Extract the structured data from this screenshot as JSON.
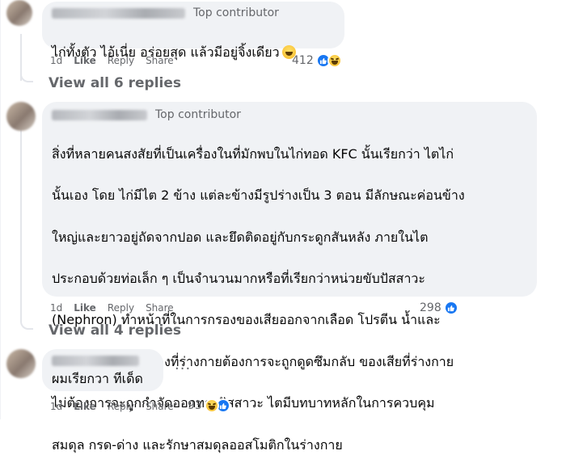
{
  "comments": [
    {
      "badge": "Top contributor",
      "text": "ไก่ทั้งตัว ไอ้เนี่ย อร่อยสุด แล้วมีอยู่จิ้งเดียว",
      "time": "1d",
      "like": "Like",
      "reply": "Reply",
      "share": "Share",
      "reaction_count": "412",
      "reactions": [
        "like-icon",
        "haha-icon"
      ],
      "view_replies": "View all 6 replies"
    },
    {
      "badge": "Top contributor",
      "text": "สิ่งที่หลายคนสงสัยที่เป็นเครื่องในที่มักพบในไก่ทอด KFC นั้นเรียกว่า ไตไก่ นั้นเอง โดย ไก่มีไต 2 ข้าง แต่ละข้างมีรูปร่างเป็น 3 ตอน มีลักษณะค่อนข้างใหญ่และยาวอยู่ถัดจากปอด และยึดติดอยู่กับกระดูกสันหลัง ภายในไตประกอบด้วยท่อเล็ก ๆ เป็นจำนวนมากหรือที่เรียกว่าหน่วยขับปัสสาวะ (Nephron) ทำหน้าที่ในการกรองของเสียออกจากเลือด โปรตีน น้ำและสารประกอบบางอย่างที่ร่างกายต้องการจะถูกดูดซึมกลับ ของเสียที่ร่างกายไม่ต้องการจะถูกกำจัดออกทางปัสสาวะ ไตมีบทบาทหลักในการควบคุมสมดุล กรด-ด่าง และรักษาสมดุลออสโมติกในร่างกาย",
      "lines": [
        "สิ่งที่หลายคนสงสัยที่เป็นเครื่องในที่มักพบในไก่ทอด KFC นั้นเรียกว่า ไตไก่",
        "นั้นเอง โดย ไก่มีไต 2 ข้าง แต่ละข้างมีรูปร่างเป็น 3 ตอน มีลักษณะค่อนข้าง",
        "ใหญ่และยาวอยู่ถัดจากปอด และยึดติดอยู่กับกระดูกสันหลัง ภายในไต",
        "ประกอบด้วยท่อเล็ก ๆ เป็นจำนวนมากหรือที่เรียกว่าหน่วยขับปัสสาวะ",
        "(Nephron) ทำหน้าที่ในการกรองของเสียออกจากเลือด โปรตีน น้ำและ",
        "สารประกอบบางอย่างที่ร่างกายต้องการจะถูกดูดซึมกลับ ของเสียที่ร่างกาย",
        "ไม่ต้องการจะถูกกำจัดออกทางปัสสาวะ ไตมีบทบาทหลักในการควบคุม",
        "สมดุล กรด-ด่าง และรักษาสมดุลออสโมติกในร่างกาย"
      ],
      "time": "1d",
      "like": "Like",
      "reply": "Reply",
      "share": "Share",
      "reaction_count": "298",
      "reactions": [
        "like-icon"
      ],
      "view_replies": "View all 4 replies"
    },
    {
      "text": "ผมเรียกวา ทีเด็ด",
      "time": "1d",
      "like": "Like",
      "reply": "Reply",
      "share": "Share",
      "reaction_count": "93",
      "reactions": [
        "haha-icon",
        "like-icon"
      ],
      "more": "···"
    }
  ]
}
